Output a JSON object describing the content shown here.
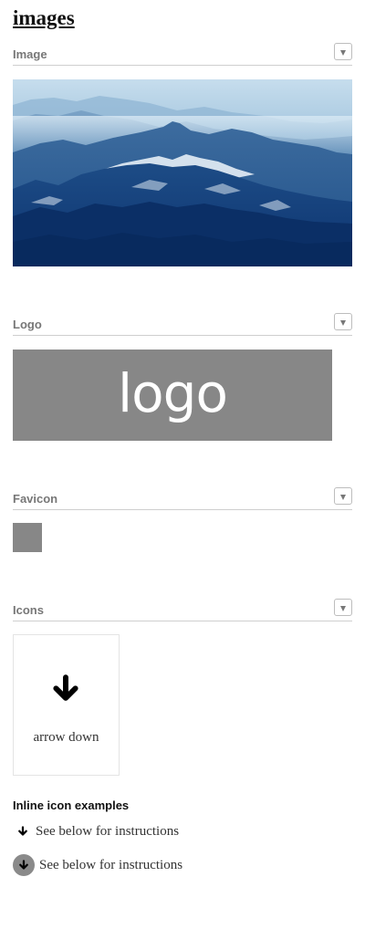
{
  "page": {
    "title": "images"
  },
  "sections": {
    "image": {
      "title": "Image"
    },
    "logo": {
      "title": "Logo",
      "logo_text": "logo"
    },
    "favicon": {
      "title": "Favicon"
    },
    "icons": {
      "title": "Icons",
      "card_icon": "arrow-down-icon",
      "card_label": "arrow down"
    }
  },
  "inline_icons": {
    "heading": "Inline icon examples",
    "row1_icon": "arrow-down-icon",
    "row1_text": "See below for instructions",
    "row2_icon": "arrow-down-circle-icon",
    "row2_text": "See below for instructions"
  },
  "colors": {
    "placeholder_gray": "#878787",
    "circle_gray": "#8a8a8a",
    "header_text": "#777777"
  }
}
